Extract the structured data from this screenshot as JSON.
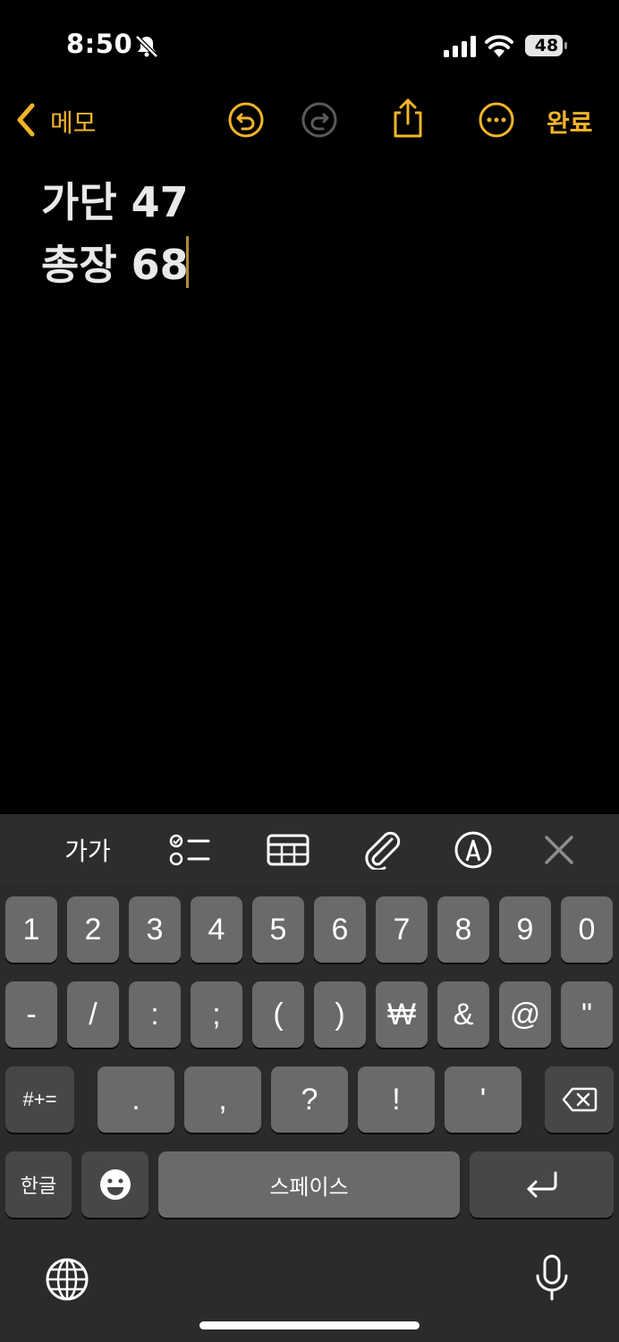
{
  "status_bar": {
    "time": "8:50",
    "battery": "48"
  },
  "nav": {
    "back_label": "메모",
    "done_label": "완료"
  },
  "note": {
    "lines": [
      "가단 47",
      "총장 68"
    ]
  },
  "format_bar": {
    "text_style_label": "가가"
  },
  "keyboard": {
    "row1": [
      "1",
      "2",
      "3",
      "4",
      "5",
      "6",
      "7",
      "8",
      "9",
      "0"
    ],
    "row2": [
      "-",
      "/",
      ":",
      ";",
      "(",
      ")",
      "₩",
      "&",
      "@",
      "\""
    ],
    "row3_left": "#+=",
    "row3": [
      ".",
      ",",
      "?",
      "!",
      "'"
    ],
    "lang_key": "한글",
    "space_label": "스페이스"
  },
  "colors": {
    "accent": "#f2b528",
    "key": "#6a6a6a",
    "key_dark": "#474747",
    "keyboard_bg": "#2b2b2b"
  }
}
